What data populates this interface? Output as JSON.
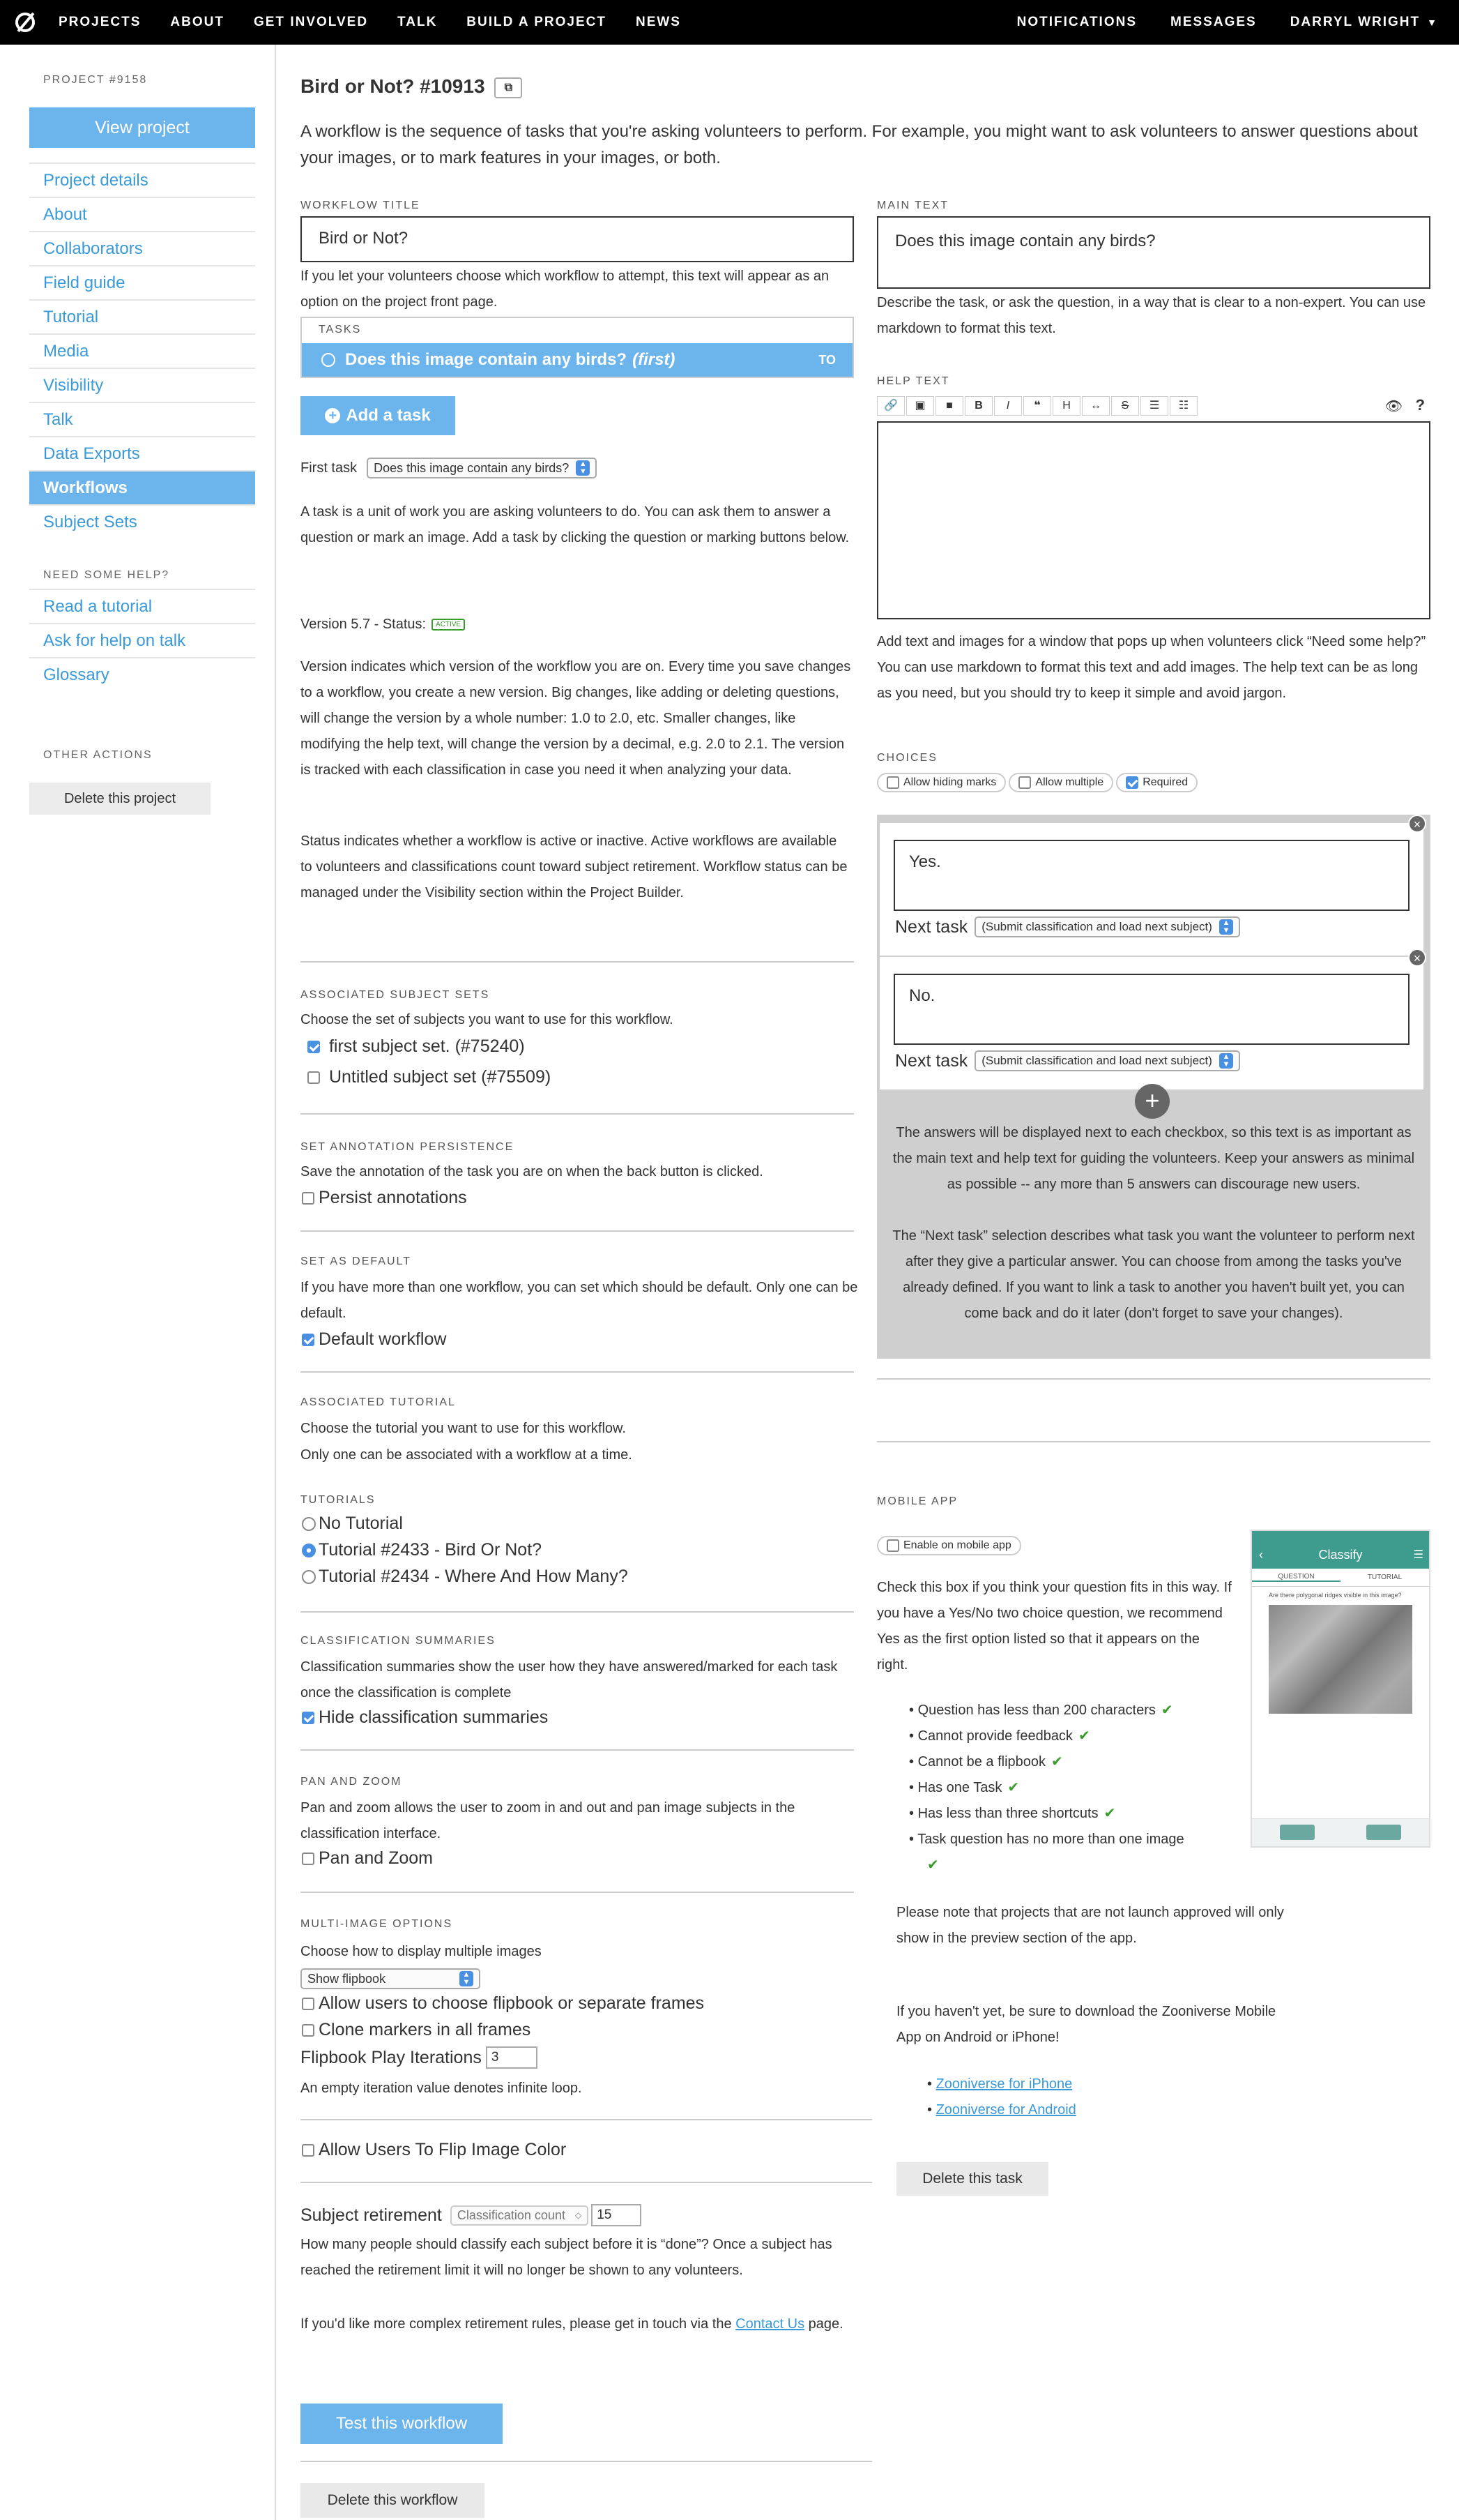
{
  "nav": {
    "links": [
      "PROJECTS",
      "ABOUT",
      "GET INVOLVED",
      "TALK",
      "BUILD A PROJECT",
      "NEWS"
    ],
    "right": [
      "NOTIFICATIONS",
      "MESSAGES",
      "DARRYL WRIGHT"
    ]
  },
  "sidebar": {
    "project_id": "PROJECT #9158",
    "view_project": "View project",
    "items": [
      "Project details",
      "About",
      "Collaborators",
      "Field guide",
      "Tutorial",
      "Media",
      "Visibility",
      "Talk",
      "Data Exports",
      "Workflows",
      "Subject Sets"
    ],
    "help_heading": "NEED SOME HELP?",
    "help_items": [
      "Read a tutorial",
      "Ask for help on talk",
      "Glossary"
    ],
    "other_heading": "OTHER ACTIONS",
    "delete_project": "Delete this project"
  },
  "main": {
    "title": "Bird or Not? #10913",
    "intro": "A workflow is the sequence of tasks that you're asking volunteers to perform. For example, you might want to ask volunteers to answer questions about your images, or to mark features in your images, or both.",
    "workflow_title_label": "WORKFLOW TITLE",
    "workflow_title_value": "Bird or Not?",
    "workflow_title_help": "If you let your volunteers choose which workflow to attempt, this text will appear as an option on the project front page.",
    "tasks_label": "TASKS",
    "task_item": "Does this image contain any birds?",
    "task_item_suffix": "(first)",
    "task_item_badge": "TO",
    "add_task": "Add a task",
    "first_task_label": "First task",
    "first_task_value": "Does this image contain any birds?",
    "task_help": "A task is a unit of work you are asking volunteers to do. You can ask them to answer a question or mark an image. Add a task by clicking the question or marking buttons below.",
    "version": "Version 5.7 - Status:",
    "status_badge": "ACTIVE",
    "version_help": "Version indicates which version of the workflow you are on. Every time you save changes to a workflow, you create a new version. Big changes, like adding or deleting questions, will change the version by a whole number: 1.0 to 2.0, etc. Smaller changes, like modifying the help text, will change the version by a decimal, e.g. 2.0 to 2.1. The version is tracked with each classification in case you need it when analyzing your data.",
    "status_help": "Status indicates whether a workflow is active or inactive. Active workflows are available to volunteers and classifications count toward subject retirement. Workflow status can be managed under the Visibility section within the Project Builder.",
    "subject_sets_label": "ASSOCIATED SUBJECT SETS",
    "subject_sets_help": "Choose the set of subjects you want to use for this workflow.",
    "subject_set_1": "first subject set. (#75240)",
    "subject_set_2": "Untitled subject set (#75509)",
    "persistence_label": "SET ANNOTATION PERSISTENCE",
    "persistence_help": "Save the annotation of the task you are on when the back button is clicked.",
    "persist_annotations": "Persist annotations",
    "default_label": "SET AS DEFAULT",
    "default_help": "If you have more than one workflow, you can set which should be default. Only one can be default.",
    "default_workflow": "Default workflow",
    "tutorial_label": "ASSOCIATED TUTORIAL",
    "tutorial_help_1": "Choose the tutorial you want to use for this workflow.",
    "tutorial_help_2": "Only one can be associated with a workflow at a time.",
    "tutorials_label": "TUTORIALS",
    "tutorial_opts": [
      "No Tutorial",
      "Tutorial #2433 - Bird Or Not?",
      "Tutorial #2434 - Where And How Many?"
    ],
    "summaries_label": "CLASSIFICATION SUMMARIES",
    "summaries_help": "Classification summaries show the user how they have answered/marked for each task once the classification is complete",
    "hide_summaries": "Hide classification summaries",
    "panzoom_label": "PAN AND ZOOM",
    "panzoom_help": "Pan and zoom allows the user to zoom in and out and pan image subjects in the classification interface.",
    "panzoom": "Pan and Zoom",
    "multi_label": "MULTI-IMAGE OPTIONS",
    "multi_help": "Choose how to display multiple images",
    "multi_select": "Show flipbook",
    "allow_flipbook": "Allow users to choose flipbook or separate frames",
    "clone_markers": "Clone markers in all frames",
    "flipbook_iterations": "Flipbook Play Iterations",
    "flipbook_iterations_value": "3",
    "flipbook_help": "An empty iteration value denotes infinite loop.",
    "flip_color": "Allow Users To Flip Image Color",
    "retirement_label": "Subject retirement",
    "retirement_select": "Classification count",
    "retirement_value": "15",
    "retirement_help": "How many people should classify each subject before it is “done”? Once a subject has reached the retirement limit it will no longer be shown to any volunteers.",
    "retirement_more": "If you'd like more complex retirement rules, please get in touch via the",
    "contact_us": "Contact Us",
    "retirement_more_end": "page.",
    "test_workflow": "Test this workflow",
    "delete_workflow": "Delete this workflow"
  },
  "right": {
    "main_text_label": "MAIN TEXT",
    "main_text_value": "Does this image contain any birds?",
    "main_text_help": "Describe the task, or ask the question, in a way that is clear to a non-expert. You can use markdown to format this text.",
    "help_text_label": "HELP TEXT",
    "help_text_help": "Add text and images for a window that pops up when volunteers click “Need some help?” You can use markdown to format this text and add images. The help text can be as long as you need, but you should try to keep it simple and avoid jargon.",
    "choices_label": "CHOICES",
    "choice_pills": [
      "Allow hiding marks",
      "Allow multiple",
      "Required"
    ],
    "answers": [
      "Yes.",
      "No."
    ],
    "next_task_label": "Next task",
    "next_task_value": "(Submit classification and load next subject)",
    "answers_help": "The answers will be displayed next to each checkbox, so this text is as important as the main text and help text for guiding the volunteers. Keep your answers as minimal as possible -- any more than 5 answers can discourage new users.",
    "next_help": "The “Next task” selection describes what task you want the volunteer to perform next after they give a particular answer. You can choose from among the tasks you've already defined. If you want to link a task to another you haven't built yet, you can come back and do it later (don't forget to save your changes).",
    "mobile_label": "MOBILE APP",
    "enable_mobile": "Enable on mobile app",
    "mobile_help": "Check this box if you think your question fits in this way. If you have a Yes/No two choice question, we recommend Yes as the first option listed so that it appears on the right.",
    "criteria": [
      "Question has less than 200 characters",
      "Cannot provide feedback",
      "Cannot be a flipbook",
      "Has one Task",
      "Has less than three shortcuts",
      "Task question has no more than one image"
    ],
    "note": "Please note that projects that are not launch approved will only show in the preview section of the app.",
    "download": "If you haven't yet, be sure to download the Zooniverse Mobile App on Android or iPhone!",
    "links": [
      "Zooniverse for iPhone",
      "Zooniverse for Android"
    ],
    "delete_task": "Delete this task",
    "phone": {
      "title": "Classify",
      "tabs": [
        "QUESTION",
        "TUTORIAL"
      ],
      "question": "Are there polygonal ridges visible in this image?"
    }
  },
  "colors": {
    "accent": "#6cb4ec",
    "link": "#3a9ad9",
    "check": "#3a9c2b"
  }
}
